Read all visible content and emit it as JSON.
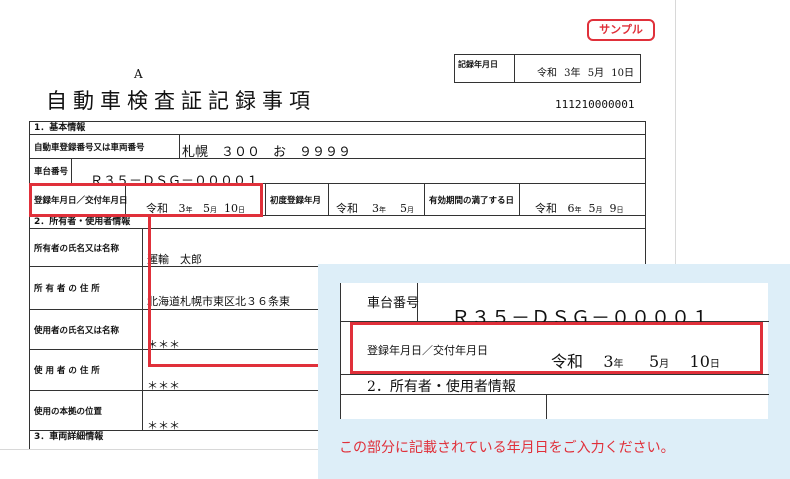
{
  "badge": "サンプル",
  "document": {
    "letter": "A",
    "title": "自動車検査証記録事項",
    "number": "111210000001",
    "record_date": {
      "label": "記録年月日",
      "era": "令和",
      "year": "3年",
      "month": "5月",
      "day": "10日"
    }
  },
  "sections": {
    "basic": "1．基本情報",
    "owner": "2．所有者・使用者情報",
    "vehicle": "3．車両詳細情報"
  },
  "fields": {
    "plate": {
      "label": "自動車登録番号又は車両番号",
      "value": "札幌　３００　お　９９９９"
    },
    "chassis": {
      "label": "車台番号",
      "value": "Ｒ３５－ＤＳＧ－００００１"
    },
    "reg_date": {
      "label": "登録年月日／交付年月日",
      "era": "令和",
      "year": "3",
      "year_unit": "年",
      "month": "5",
      "month_unit": "月",
      "day": "10",
      "day_unit": "日"
    },
    "first_reg": {
      "label": "初度登録年月",
      "era": "令和",
      "year": "3",
      "year_unit": "年",
      "month": "5",
      "month_unit": "月"
    },
    "expiry": {
      "label": "有効期間の満了する日",
      "era": "令和",
      "year": "6",
      "year_unit": "年",
      "month": "5",
      "month_unit": "月",
      "day": "9",
      "day_unit": "日"
    },
    "owner_name": {
      "label": "所有者の氏名又は名称",
      "value": "運輸　太郎"
    },
    "owner_address": {
      "label": "所 有 者 の 住 所",
      "value": "北海道札幌市東区北３６条東"
    },
    "user_name": {
      "label": "使用者の氏名又は名称",
      "value": "＊＊＊"
    },
    "user_address": {
      "label": "使 用 者 の 住 所",
      "value": "＊＊＊"
    },
    "base_location": {
      "label": "使用の本拠の位置",
      "value": "＊＊＊"
    }
  },
  "callout": {
    "chassis_label": "車台番号",
    "chassis_value": "Ｒ３５－ＤＳＧ－００００１",
    "date_label": "登録年月日／交付年月日",
    "era": "令和",
    "year": "3",
    "year_unit": "年",
    "month": "5",
    "month_unit": "月",
    "day": "10",
    "day_unit": "日",
    "section": "2．所有者・使用者情報",
    "message": "この部分に記載されている年月日をご入力ください。"
  },
  "colors": {
    "accent": "#e0303a",
    "callout_bg": "#ddeef8"
  }
}
